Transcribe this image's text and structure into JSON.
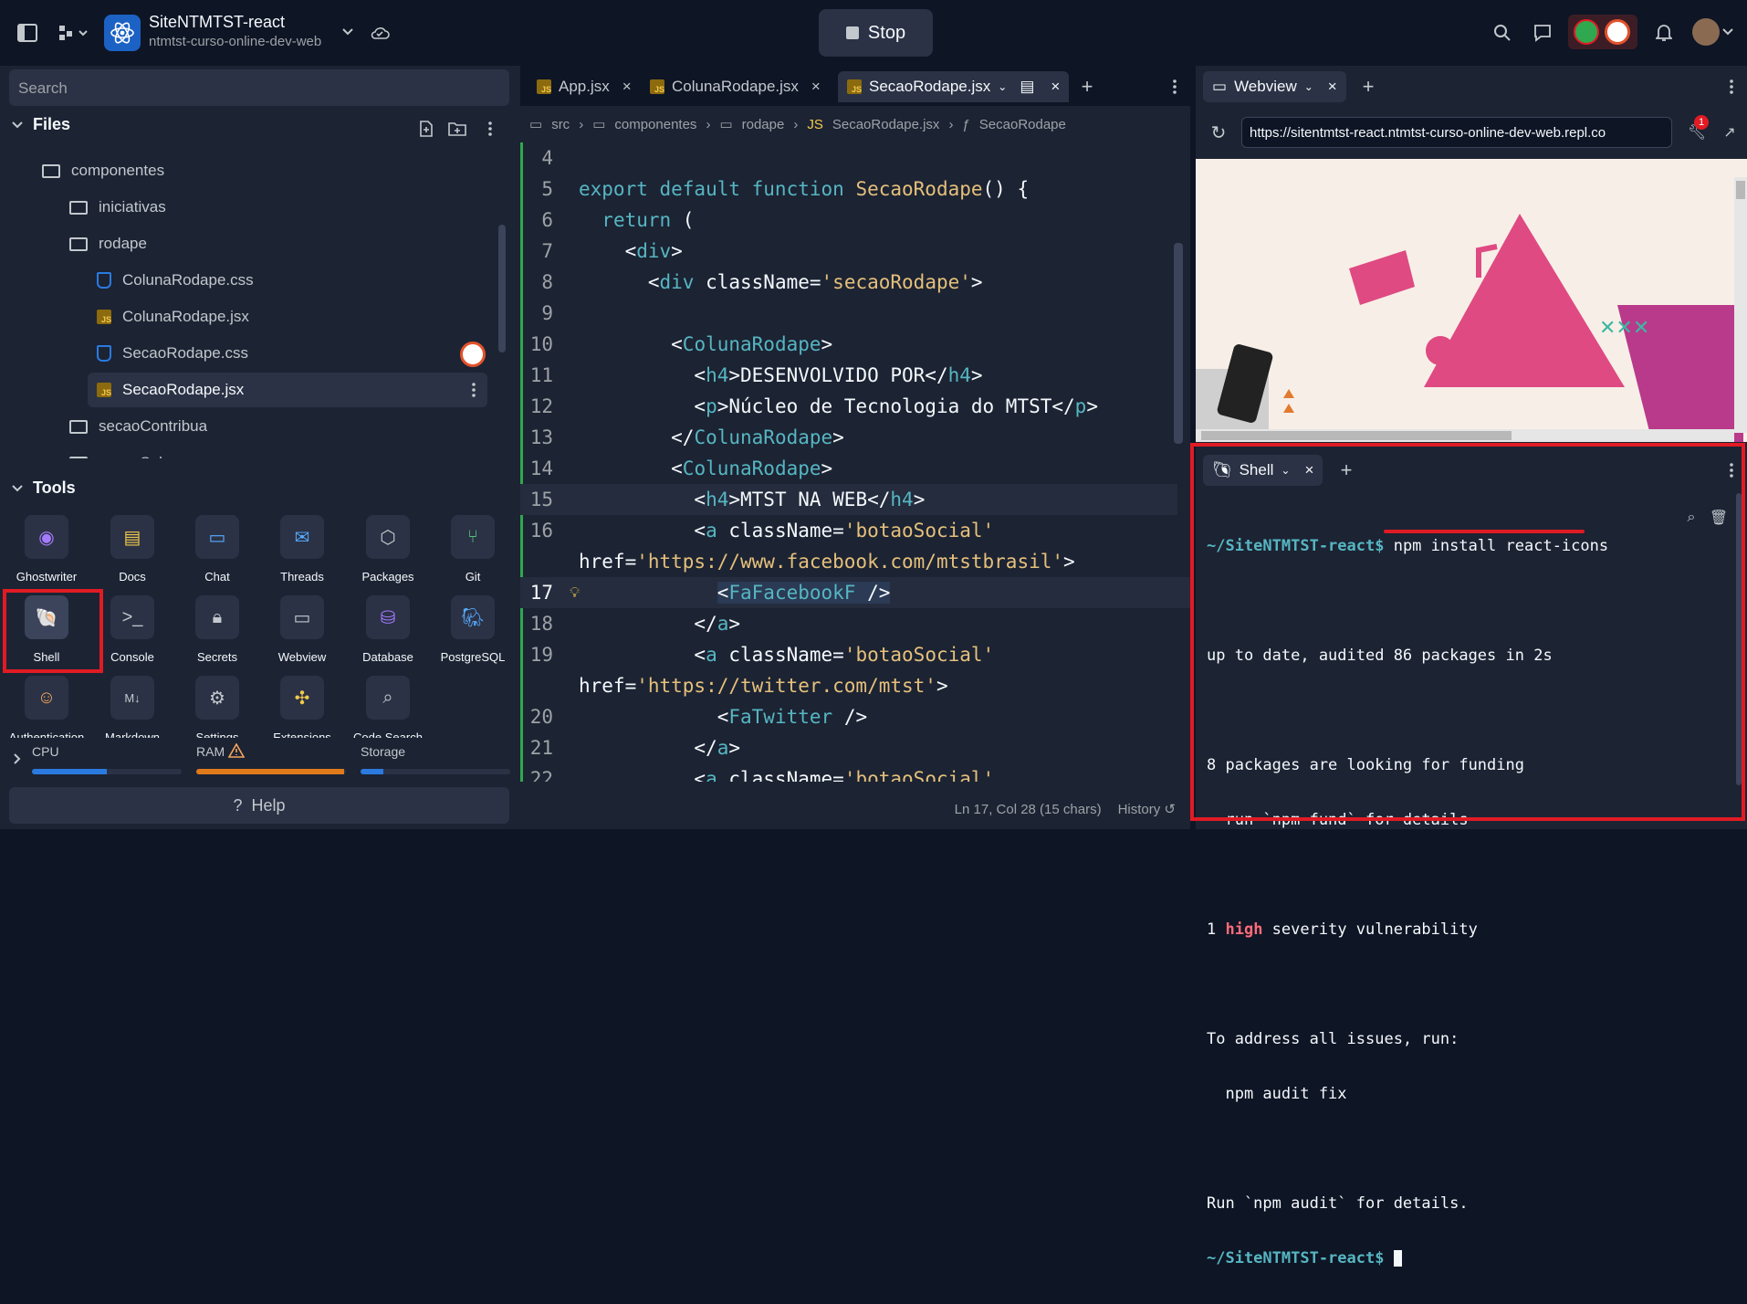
{
  "app": {
    "title": "SiteNTMTST-react",
    "subtitle": "ntmtst-curso-online-dev-web",
    "stop_label": "Stop"
  },
  "left": {
    "search_placeholder": "Search",
    "files_title": "Files",
    "tree": [
      {
        "label": "componentes",
        "type": "folder"
      },
      {
        "label": "iniciativas",
        "type": "folder"
      },
      {
        "label": "rodape",
        "type": "folder"
      },
      {
        "label": "ColunaRodape.css",
        "type": "css"
      },
      {
        "label": "ColunaRodape.jsx",
        "type": "jsx"
      },
      {
        "label": "SecaoRodape.css",
        "type": "css"
      },
      {
        "label": "SecaoRodape.jsx",
        "type": "jsx"
      },
      {
        "label": "secaoContribua",
        "type": "folder"
      },
      {
        "label": "secaoSobre",
        "type": "folder"
      }
    ],
    "tools_title": "Tools",
    "tools": [
      {
        "label": "Ghostwriter",
        "icon": "ghostwriter-icon"
      },
      {
        "label": "Docs",
        "icon": "docs-icon"
      },
      {
        "label": "Chat",
        "icon": "chat-icon"
      },
      {
        "label": "Threads",
        "icon": "threads-icon"
      },
      {
        "label": "Packages",
        "icon": "packages-icon"
      },
      {
        "label": "Git",
        "icon": "git-icon"
      },
      {
        "label": "Shell",
        "icon": "shell-icon"
      },
      {
        "label": "Console",
        "icon": "console-icon"
      },
      {
        "label": "Secrets",
        "icon": "lock-icon"
      },
      {
        "label": "Webview",
        "icon": "monitor-icon"
      },
      {
        "label": "Database",
        "icon": "database-icon"
      },
      {
        "label": "PostgreSQL",
        "icon": "postgresql-icon"
      },
      {
        "label": "Authentication",
        "icon": "user-icon"
      },
      {
        "label": "Markdown",
        "icon": "markdown-icon"
      },
      {
        "label": "Settings",
        "icon": "gear-icon"
      },
      {
        "label": "Extensions",
        "icon": "puzzle-icon"
      },
      {
        "label": "Code Search",
        "icon": "search-icon"
      }
    ],
    "meters": {
      "cpu": "CPU",
      "ram": "RAM",
      "storage": "Storage",
      "cpu_level": 0.5,
      "ram_level": 0.99,
      "storage_level": 0.15
    },
    "help_label": "Help"
  },
  "editor": {
    "tabs": [
      "App.jsx",
      "ColunaRodape.jsx",
      "SecaoRodape.jsx"
    ],
    "breadcrumb": [
      "src",
      "componentes",
      "rodape",
      "SecaoRodape.jsx",
      "SecaoRodape"
    ],
    "status_position": "Ln 17, Col 28 (15 chars)",
    "status_history": "History"
  },
  "webview": {
    "tab_label": "Webview",
    "url": "https://sitentmtst-react.ntmtst-curso-online-dev-web.repl.co",
    "badge": "1"
  },
  "shell": {
    "tab_label": "Shell",
    "prompt": "~/SiteNTMTST-react$",
    "command": " npm install react-icons",
    "out1": "up to date, audited 86 packages in 2s",
    "out2": "8 packages are looking for funding",
    "out3": "  run `npm fund` for details",
    "out4a": "1 ",
    "out4b": "high",
    "out4c": " severity vulnerability",
    "out5": "To address all issues, run:",
    "out6": "  npm audit fix",
    "out7": "Run `npm audit` for details."
  },
  "colors": {
    "accent": "#e01b24",
    "background": "#0e1525",
    "panel": "#1c2333"
  }
}
